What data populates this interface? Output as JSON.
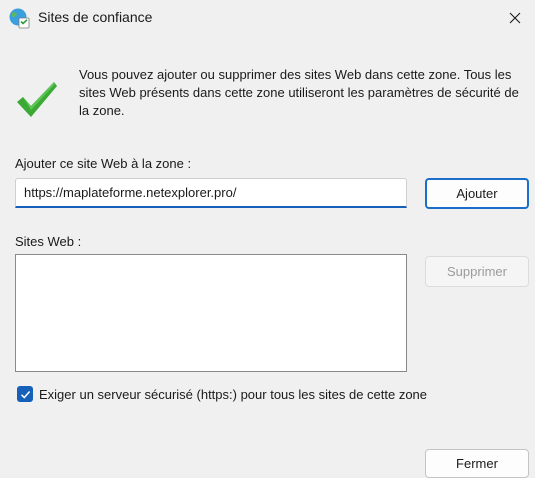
{
  "window": {
    "title": "Sites de confiance",
    "title_icon": "trusted-sites-globe-icon",
    "close_icon": "close-icon"
  },
  "intro": {
    "icon": "green-check-icon",
    "text": "Vous pouvez ajouter ou supprimer des sites Web dans cette zone. Tous les sites Web présents dans cette zone utiliseront les paramètres de sécurité de la zone."
  },
  "add_site": {
    "label": "Ajouter ce site Web à la zone :",
    "value": "https://maplateforme.netexplorer.pro/",
    "button": "Ajouter"
  },
  "websites": {
    "label": "Sites Web :",
    "items": [],
    "remove_button": "Supprimer",
    "remove_enabled": false
  },
  "require_https": {
    "label": "Exiger un serveur sécurisé (https:) pour tous les sites de cette zone",
    "checked": true
  },
  "footer": {
    "close_button": "Fermer"
  },
  "colors": {
    "accent": "#1560b8",
    "background": "#f0f0f0",
    "check_green": "#3aaa35"
  }
}
